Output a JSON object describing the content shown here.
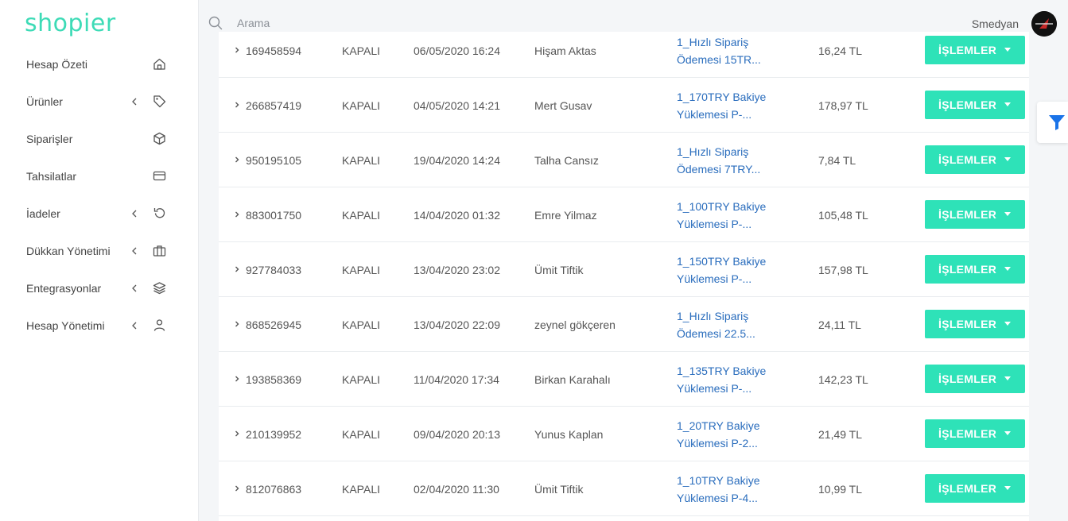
{
  "app": {
    "logo": "shopier"
  },
  "sidebar": {
    "items": [
      {
        "label": "Hesap Özeti",
        "icon": "home-icon",
        "has_chevron": false
      },
      {
        "label": "Ürünler",
        "icon": "tag-icon",
        "has_chevron": true
      },
      {
        "label": "Siparişler",
        "icon": "box-icon",
        "has_chevron": false
      },
      {
        "label": "Tahsilatlar",
        "icon": "credit-card-icon",
        "has_chevron": false
      },
      {
        "label": "İadeler",
        "icon": "refresh-icon",
        "has_chevron": true
      },
      {
        "label": "Dükkan Yönetimi",
        "icon": "briefcase-icon",
        "has_chevron": true
      },
      {
        "label": "Entegrasyonlar",
        "icon": "layers-icon",
        "has_chevron": true
      },
      {
        "label": "Hesap Yönetimi",
        "icon": "user-icon",
        "has_chevron": true
      }
    ]
  },
  "topbar": {
    "search_placeholder": "Arama",
    "username": "Smedyan"
  },
  "orders": {
    "action_label": "İŞLEMLER",
    "rows": [
      {
        "id": "169458594",
        "status": "KAPALI",
        "date": "06/05/2020 16:24",
        "customer": "Hişam Aktas",
        "product_line1": "1_Hızlı Sipariş",
        "product_line2": "Ödemesi 15TR...",
        "amount": "16,24 TL"
      },
      {
        "id": "266857419",
        "status": "KAPALI",
        "date": "04/05/2020 14:21",
        "customer": "Mert Gusav",
        "product_line1": "1_170TRY Bakiye",
        "product_line2": "Yüklemesi P-...",
        "amount": "178,97 TL"
      },
      {
        "id": "950195105",
        "status": "KAPALI",
        "date": "19/04/2020 14:24",
        "customer": "Talha Cansız",
        "product_line1": "1_Hızlı Sipariş",
        "product_line2": "Ödemesi 7TRY...",
        "amount": "7,84 TL"
      },
      {
        "id": "883001750",
        "status": "KAPALI",
        "date": "14/04/2020 01:32",
        "customer": "Emre Yilmaz",
        "product_line1": "1_100TRY Bakiye",
        "product_line2": "Yüklemesi P-...",
        "amount": "105,48 TL"
      },
      {
        "id": "927784033",
        "status": "KAPALI",
        "date": "13/04/2020 23:02",
        "customer": "Ümit Tiftik",
        "product_line1": "1_150TRY Bakiye",
        "product_line2": "Yüklemesi P-...",
        "amount": "157,98 TL"
      },
      {
        "id": "868526945",
        "status": "KAPALI",
        "date": "13/04/2020 22:09",
        "customer": "zeynel gökçeren",
        "product_line1": "1_Hızlı Sipariş",
        "product_line2": "Ödemesi 22.5...",
        "amount": "24,11 TL"
      },
      {
        "id": "193858369",
        "status": "KAPALI",
        "date": "11/04/2020 17:34",
        "customer": "Birkan Karahalı",
        "product_line1": "1_135TRY Bakiye",
        "product_line2": "Yüklemesi P-...",
        "amount": "142,23 TL"
      },
      {
        "id": "210139952",
        "status": "KAPALI",
        "date": "09/04/2020 20:13",
        "customer": "Yunus Kaplan",
        "product_line1": "1_20TRY Bakiye",
        "product_line2": "Yüklemesi P-2...",
        "amount": "21,49 TL"
      },
      {
        "id": "812076863",
        "status": "KAPALI",
        "date": "02/04/2020 11:30",
        "customer": "Ümit Tiftik",
        "product_line1": "1_10TRY Bakiye",
        "product_line2": "Yüklemesi P-4...",
        "amount": "10,99 TL"
      }
    ]
  },
  "colors": {
    "brand": "#3ddbb6",
    "action_button": "#2ee2b8",
    "link": "#2a6dbd",
    "filter_icon": "#1a73e8"
  }
}
